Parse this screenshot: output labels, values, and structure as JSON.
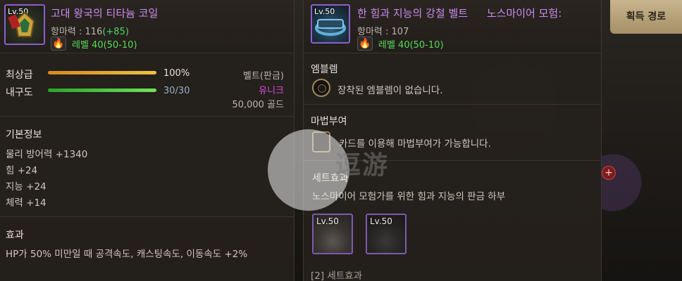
{
  "left_item": {
    "level_tag": "Lv.50",
    "name": "고대 왕국의 티타늄 코일",
    "defense_label": "항마력 : 116",
    "defense_bonus": "(+85)",
    "level_range": "레벨 40(50-10)",
    "quality_label": "최상급",
    "quality_value": "100%",
    "quality_fraction": 1.0,
    "durability_label": "내구도",
    "durability_value": "30/30",
    "durability_fraction": 1.0,
    "type": "벨트(판금)",
    "rarity": "유니크",
    "price": "50,000 골드",
    "basic_info_title": "기본정보",
    "stats": [
      "물리 방어력 +1340",
      "힘 +24",
      "지능 +24",
      "체력 +14"
    ],
    "effect_title": "효과",
    "effect_text": "HP가 50% 미만일 때 공격속도, 캐스팅속도, 이동속도 +2%"
  },
  "right_item": {
    "level_tag": "Lv.50",
    "name": "한 힘과 지능의 강철 벨트",
    "name_suffix": "노스마이어 모험:",
    "defense_label": "항마력 : 107",
    "level_range": "레벨 40(50-10)",
    "emblem_title": "엠블렘",
    "emblem_text": "장착된 엠블렘이 없습니다.",
    "enchant_title": "마법부여",
    "enchant_text": "카드를 이용해 마법부여가 가능합니다.",
    "set_title": "세트효과",
    "set_name": "노스마이어 모험가를 위한 힘과 지능의 판금 하부",
    "set_items": [
      {
        "level": "Lv.50"
      },
      {
        "level": "Lv.50"
      }
    ],
    "set_effect_label": "[2] 세트효과"
  },
  "acquire_button": "획득 경로",
  "watermark": "逗游",
  "colors": {
    "epic_purple": "#c98cf0",
    "unique_magenta": "#e04ae0",
    "green_bonus": "#4fd66a",
    "gold_button": "#b8a078"
  }
}
